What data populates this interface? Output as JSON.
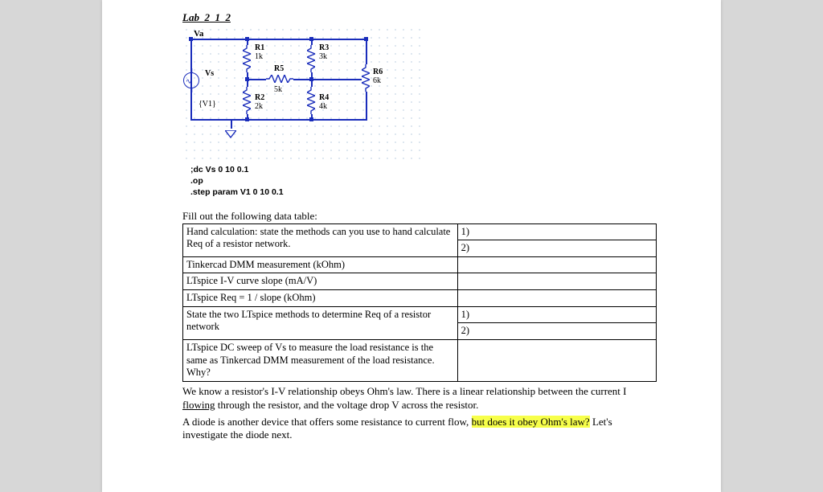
{
  "title": "Lab_2_1_2",
  "schematic": {
    "node_label": "Va",
    "source": {
      "name": "Vs",
      "value": "{V1}"
    },
    "resistors": {
      "R1": {
        "label": "R1",
        "value": "1k"
      },
      "R2": {
        "label": "R2",
        "value": "2k"
      },
      "R3": {
        "label": "R3",
        "value": "3k"
      },
      "R4": {
        "label": "R4",
        "value": "4k"
      },
      "R5": {
        "label": "R5",
        "value": "5k"
      },
      "R6": {
        "label": "R6",
        "value": "6k"
      }
    },
    "directives": {
      "dc": ";dc Vs 0 10 0.1",
      "op": ".op",
      "step": ".step param V1 0 10 0.1"
    }
  },
  "table_prompt": "Fill out the following data table:",
  "table": {
    "row1": "Hand calculation: state the methods can you use to hand calculate Req of a resistor network.",
    "row1_a": "1)",
    "row1_b": "2)",
    "row2": "Tinkercad DMM measurement (kOhm)",
    "row3": "LTspice I-V curve slope (mA/V)",
    "row4": "LTspice Req = 1 / slope (kOhm)",
    "row5": "State the two LTspice methods to determine Req of a resistor network",
    "row5_a": "1)",
    "row5_b": "2)",
    "row6": "LTspice DC sweep of Vs to measure the load resistance is the same as Tinkercad DMM measurement of the load resistance. Why?"
  },
  "body": {
    "p1a": "We know a resistor's I-V relationship obeys Ohm's law. There is a linear relationship between the current I ",
    "p1u": "flowing",
    "p1b": " through the resistor, and the voltage drop V across the resistor.",
    "p2a": "A diode is another device that offers some resistance to current flow, ",
    "p2hl": "but does it obey Ohm's law?",
    "p2b": " Let's investigate the diode next."
  }
}
